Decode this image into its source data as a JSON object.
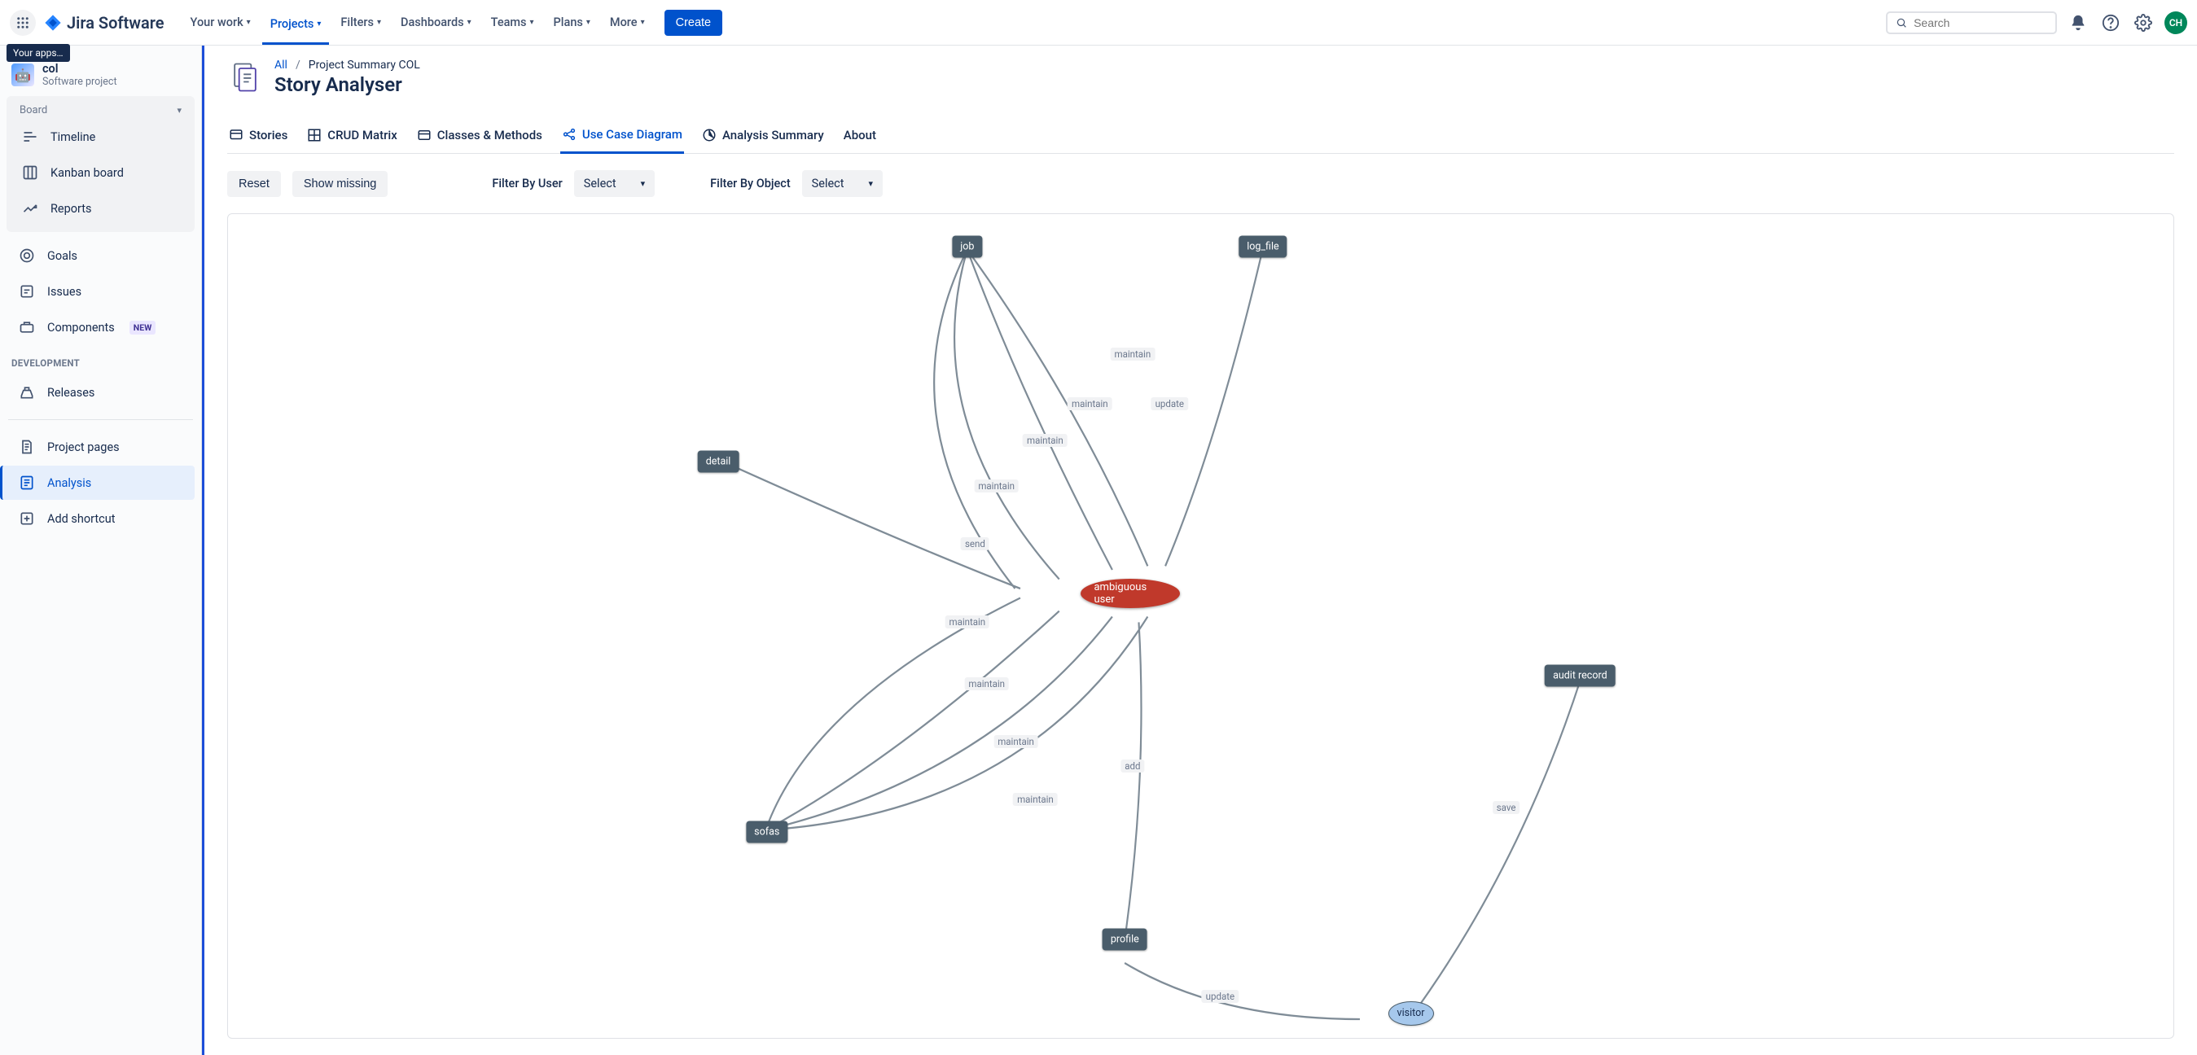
{
  "brand": {
    "name": "Jira Software"
  },
  "topnav": {
    "items": [
      {
        "label": "Your work"
      },
      {
        "label": "Projects"
      },
      {
        "label": "Filters"
      },
      {
        "label": "Dashboards"
      },
      {
        "label": "Teams"
      },
      {
        "label": "Plans"
      },
      {
        "label": "More"
      }
    ],
    "create": "Create",
    "search_placeholder": "Search",
    "avatar": "CH"
  },
  "tooltip": "Your apps…",
  "project": {
    "name": "col",
    "subtitle": "Software project"
  },
  "sidebar": {
    "board_label": "Board",
    "items_a": [
      {
        "label": "Timeline"
      },
      {
        "label": "Kanban board"
      },
      {
        "label": "Reports"
      }
    ],
    "items_b": [
      {
        "label": "Goals"
      },
      {
        "label": "Issues"
      },
      {
        "label": "Components",
        "badge": "NEW"
      }
    ],
    "dev_title": "DEVELOPMENT",
    "items_c": [
      {
        "label": "Releases"
      }
    ],
    "items_d": [
      {
        "label": "Project pages"
      },
      {
        "label": "Analysis"
      },
      {
        "label": "Add shortcut"
      }
    ]
  },
  "breadcrumb": {
    "all": "All",
    "current": "Project Summary COL"
  },
  "page_title": "Story Analyser",
  "tabs": [
    {
      "label": "Stories"
    },
    {
      "label": "CRUD Matrix"
    },
    {
      "label": "Classes & Methods"
    },
    {
      "label": "Use Case Diagram"
    },
    {
      "label": "Analysis Summary"
    },
    {
      "label": "About"
    }
  ],
  "controls": {
    "reset": "Reset",
    "show_missing": "Show missing",
    "filter_user_label": "Filter By User",
    "filter_object_label": "Filter By Object",
    "select_placeholder": "Select"
  },
  "diagram": {
    "nodes": {
      "job": "job",
      "log_file": "log_file",
      "detail": "detail",
      "ambiguous_user": "ambiguous user",
      "sofas": "sofas",
      "profile": "profile",
      "audit_record": "audit record",
      "visitor": "visitor"
    },
    "edges": {
      "maintain1": "maintain",
      "maintain2": "maintain",
      "maintain3": "maintain",
      "maintain4": "maintain",
      "maintain5": "maintain",
      "maintain6": "maintain",
      "maintain7": "maintain",
      "maintain8": "maintain",
      "update1": "update",
      "update2": "update",
      "send": "send",
      "add": "add",
      "save": "save"
    }
  }
}
